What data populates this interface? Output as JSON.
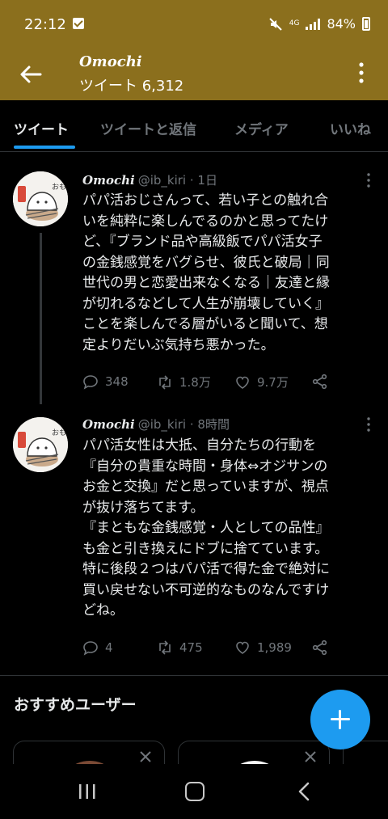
{
  "status_bar": {
    "time": "22:12",
    "network": "4G",
    "battery": "84%"
  },
  "header": {
    "name": "Omochi",
    "tweet_count": "ツイート 6,312"
  },
  "tabs": [
    "ツイート",
    "ツイートと返信",
    "メディア",
    "いいね"
  ],
  "avatar_text": "おもち",
  "tweets": [
    {
      "name": "Omochi",
      "handle": "@ib_kiri",
      "sep": "·",
      "time": "1日",
      "lines": [
        "パパ活おじさんって、若い子との触れ合",
        "いを純粋に楽しんでるのかと思ってたけ",
        "ど、『ブランド品や高級飯でパパ活女子",
        "の金銭感覚をバグらせ、彼氏と破局｜同",
        "世代の男と恋愛出来なくなる｜友達と縁",
        "が切れるなどして人生が崩壊していく』",
        "ことを楽しんでる層がいると聞いて、想",
        "定よりだいぶ気持ち悪かった。"
      ],
      "replies": "348",
      "retweets": "1.8万",
      "likes": "9.7万"
    },
    {
      "name": "Omochi",
      "handle": "@ib_kiri",
      "sep": "·",
      "time": "8時間",
      "lines": [
        "パパ活女性は大抵、自分たちの行動を",
        "『自分の貴重な時間・身体⇔オジサンの",
        "お金と交換』だと思っていますが、視点",
        "が抜け落ちてます。",
        "『まともな金銭感覚・人としての品性』",
        "も金と引き換えにドブに捨てています。",
        "特に後段２つはパパ活で得た金で絶対に",
        "買い戻せない不可逆的なものなんですけ",
        "どね。"
      ],
      "replies": "4",
      "retweets": "475",
      "likes": "1,989"
    }
  ],
  "recommended_title": "おすすめユーザー",
  "colors": {
    "header_bg": "#8b6f1d",
    "accent": "#1d9bf0",
    "text_secondary": "#71767b",
    "background": "#000000"
  },
  "icons": [
    "back-arrow-icon",
    "more-vertical-icon",
    "reply-icon",
    "retweet-icon",
    "like-icon",
    "share-icon",
    "plus-icon",
    "close-icon"
  ]
}
